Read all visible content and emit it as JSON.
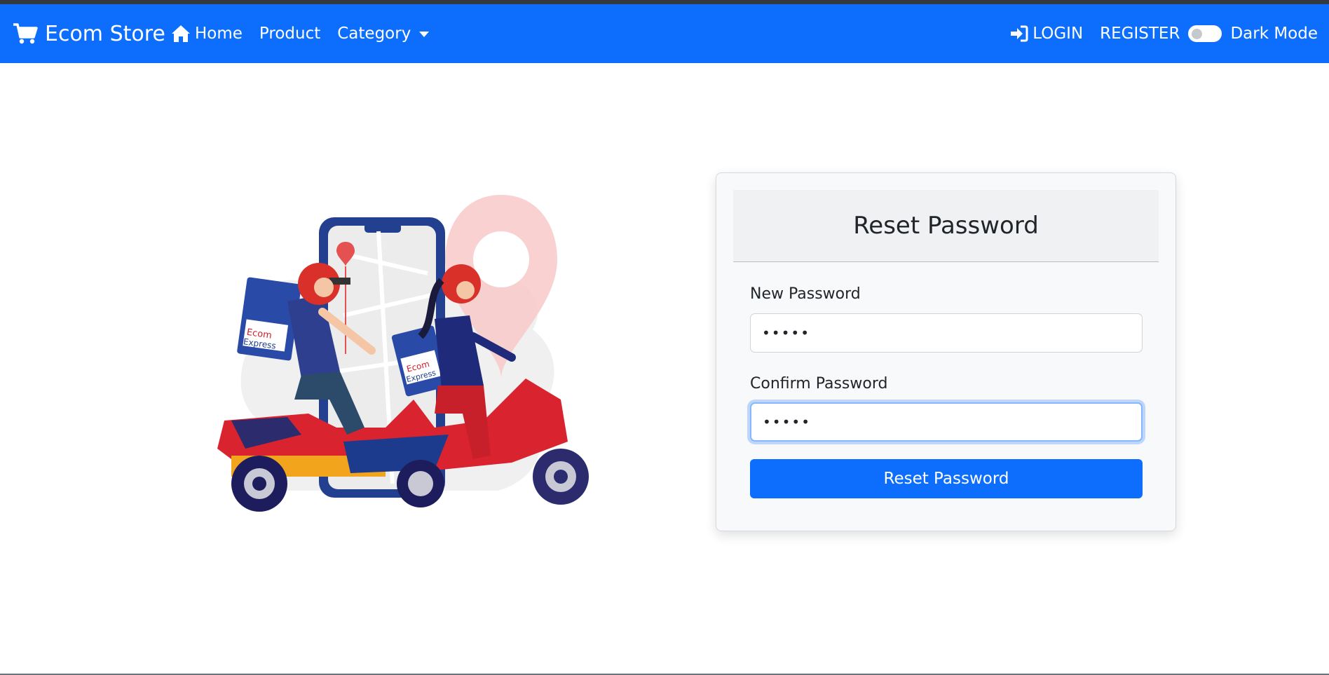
{
  "navbar": {
    "brand": "Ecom Store",
    "links": {
      "home": "Home",
      "product": "Product",
      "category": "Category"
    },
    "login": "LOGIN",
    "register": "REGISTER",
    "dark_mode": "Dark Mode",
    "color": "#0d6efd"
  },
  "illustration": {
    "box_text_1": "Ecom",
    "box_text_2": "Express"
  },
  "form": {
    "title": "Reset Password",
    "new_password_label": "New Password",
    "new_password_value": "•••••",
    "confirm_password_label": "Confirm Password",
    "confirm_password_value": "•••••",
    "submit_label": "Reset Password"
  }
}
